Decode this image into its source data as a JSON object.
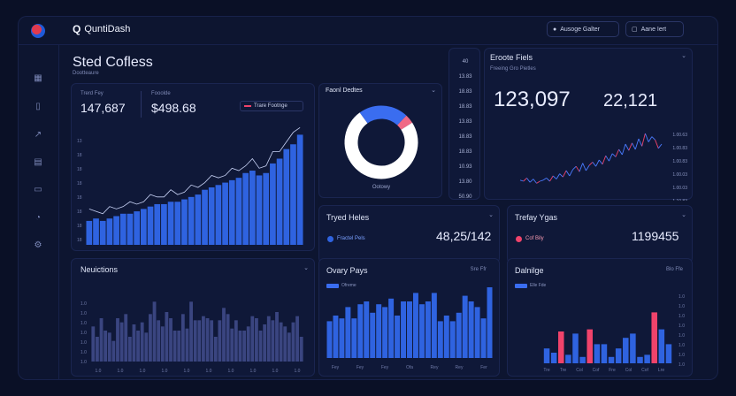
{
  "brand": {
    "name": "QuntiDash"
  },
  "topbar": {
    "btn1_label": "Ausoge Galter",
    "btn2_label": "Aane Iert"
  },
  "sidebar": {
    "icons": [
      "grid-icon",
      "file-icon",
      "share-icon",
      "chart-icon",
      "message-icon",
      "clock-icon",
      "settings-icon"
    ]
  },
  "main": {
    "title": "Sted Cofless",
    "subtitle": "Dootteaure",
    "stat1_label": "Trerd Fey",
    "stat1_value": "147,687",
    "stat2_label": "Fooolde",
    "stat2_value": "$498.68",
    "legend_label": "Trare Footnge",
    "y_ticks": [
      "13",
      "18",
      "18",
      "18",
      "18",
      "18",
      "18",
      "18"
    ]
  },
  "donut": {
    "title": "Faonl Dedtes",
    "label": "Ootowy",
    "slices": [
      {
        "name": "blue",
        "value": 22,
        "color": "#3a6df0"
      },
      {
        "name": "pink",
        "value": 4,
        "color": "#f06a86"
      },
      {
        "name": "white",
        "value": 74,
        "color": "#ffffff"
      }
    ]
  },
  "scale_col": {
    "values": [
      "40",
      "13.83",
      "18.83",
      "18.83",
      "13.83",
      "18.83",
      "18.83",
      "10.93",
      "13.80",
      "50.90"
    ]
  },
  "right_top": {
    "title": "Eroote Fiels",
    "subtitle": "Freeing Gro Pietles",
    "value1": "123,097",
    "value2": "22,121",
    "y_ticks": [
      "1.00.63",
      "1.00.83",
      "1.00.83",
      "1.00.03",
      "1.00.03",
      "1.10.83"
    ]
  },
  "tryed": {
    "title": "Tryed Heles",
    "badge": "Fractel Pels",
    "value": "48,25/142"
  },
  "trefay": {
    "title": "Trefay Ygas",
    "badge": "Cof Bily",
    "value": "1199455"
  },
  "notictions": {
    "title": "Neuictions",
    "x_ticks": [
      "1.0",
      "1.0",
      "1.0",
      "1.0",
      "1.0",
      "1.0",
      "1.0",
      "1.0",
      "1.0",
      "1.0"
    ],
    "y_ticks": [
      "1.0",
      "1.0",
      "1.0",
      "1.0",
      "1.0",
      "1.0",
      "1.0"
    ]
  },
  "ovary": {
    "title": "Ovary Pays",
    "legend": "Ofreme",
    "tag": "Sre Ffr",
    "x_ticks": [
      "Fey",
      "Fey",
      "Fey",
      "Ofa",
      "Rey",
      "Rey",
      "Fer"
    ]
  },
  "dalnilge": {
    "title": "Dalnilge",
    "legend": "Elle Fde",
    "tag": "Blo Ffe",
    "x_ticks": [
      "Tre",
      "Tre",
      "Col",
      "Cof",
      "Fre",
      "Col",
      "Cof",
      "Lre"
    ],
    "y_ticks": [
      "1.0",
      "1.0",
      "1.0",
      "1.0",
      "1.0",
      "1.0",
      "1.0",
      "1.0"
    ]
  },
  "colors": {
    "accent_blue": "#2f63e0",
    "accent_pink": "#f0436b",
    "bg": "#0a1026"
  },
  "chart_data": [
    {
      "type": "bar",
      "name": "main",
      "values": [
        10,
        11,
        10,
        11,
        12,
        13,
        13,
        14,
        15,
        16,
        17,
        17,
        18,
        18,
        19,
        20,
        21,
        23,
        24,
        25,
        26,
        27,
        28,
        30,
        31,
        29,
        30,
        34,
        36,
        40,
        42,
        46
      ]
    },
    {
      "type": "bar",
      "name": "notictions",
      "values": [
        34,
        24,
        42,
        30,
        28,
        20,
        42,
        38,
        46,
        24,
        36,
        30,
        38,
        28,
        46,
        58,
        40,
        34,
        48,
        42,
        30,
        30,
        46,
        32,
        58,
        40,
        40,
        44,
        42,
        40,
        24,
        40,
        52,
        46,
        32,
        40,
        30,
        30,
        34,
        44,
        42,
        30,
        36,
        44,
        40,
        48,
        38,
        34,
        28,
        38,
        44,
        24
      ]
    },
    {
      "type": "bar",
      "name": "ovary",
      "values": [
        26,
        30,
        28,
        36,
        28,
        38,
        40,
        32,
        38,
        36,
        42,
        30,
        40,
        40,
        46,
        38,
        40,
        46,
        26,
        30,
        26,
        32,
        44,
        40,
        36,
        28,
        50
      ]
    },
    {
      "type": "bar",
      "name": "dalnilge",
      "values": [
        14,
        10,
        30,
        8,
        28,
        6,
        32,
        18,
        18,
        6,
        14,
        24,
        28,
        6,
        8,
        48,
        32,
        18
      ]
    },
    {
      "type": "line",
      "name": "right_top",
      "values": [
        12,
        10,
        16,
        8,
        14,
        6,
        10,
        12,
        16,
        10,
        20,
        14,
        24,
        18,
        30,
        20,
        32,
        38,
        28,
        44,
        30,
        40,
        46,
        38,
        50,
        42,
        58,
        48,
        62,
        56,
        70,
        60,
        80,
        68,
        82,
        70,
        90,
        76,
        100,
        84,
        94,
        88,
        72,
        80
      ]
    }
  ]
}
